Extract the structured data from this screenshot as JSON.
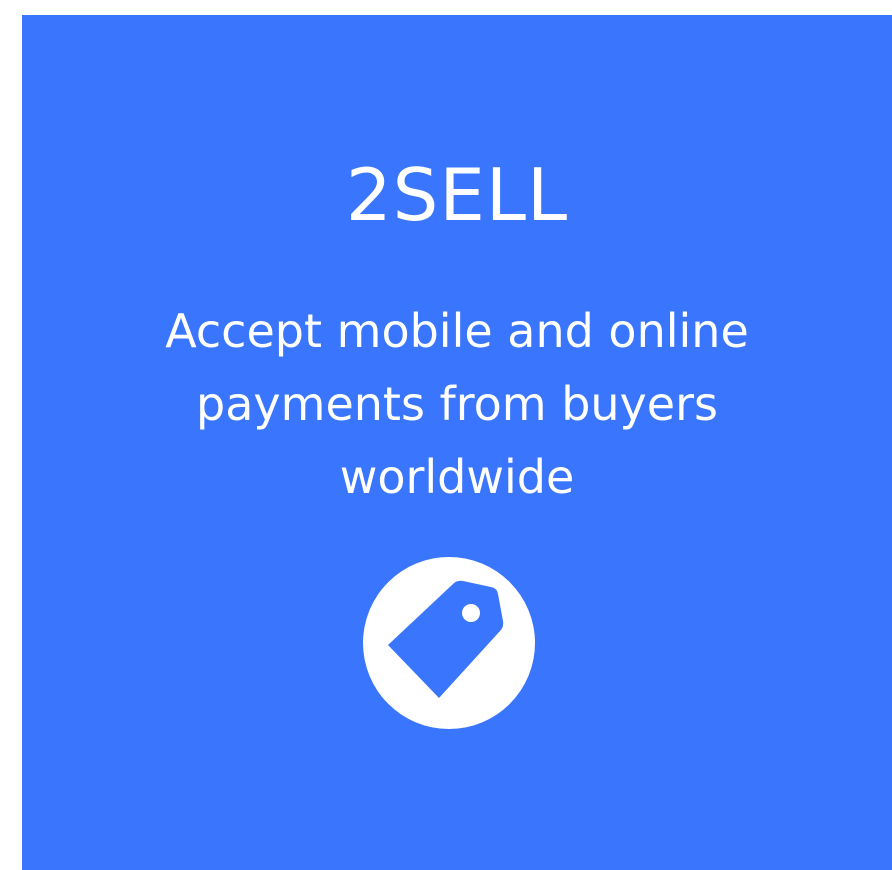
{
  "product": {
    "title": "2SELL",
    "description": "Accept mobile and online payments from buyers worldwide",
    "icon": "tag-icon"
  },
  "colors": {
    "card_background": "#3a76fd",
    "text": "#ffffff",
    "icon_circle": "#ffffff",
    "page_background": "#ffffff"
  }
}
